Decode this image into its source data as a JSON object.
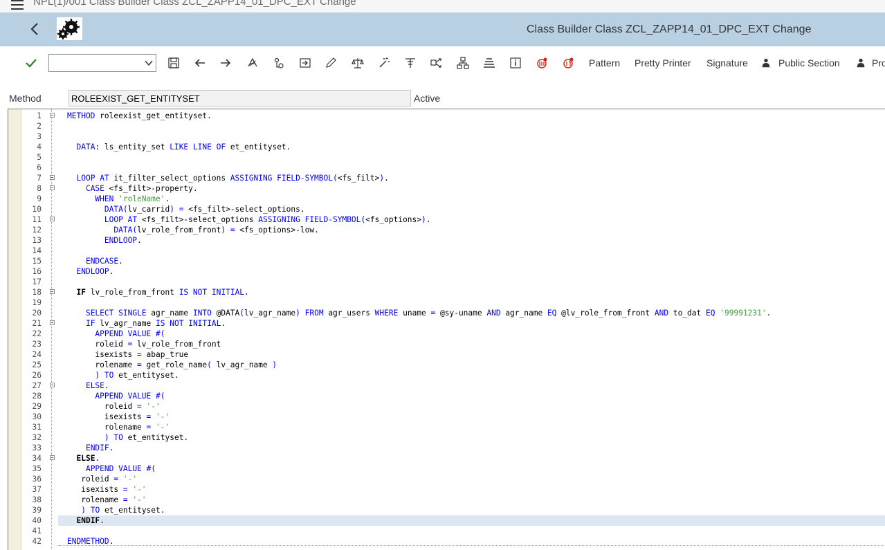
{
  "window": {
    "title": "NPL(1)/001 Class Builder Class ZCL_ZAPP14_01_DPC_EXT Change"
  },
  "shell": {
    "app_title": "Class Builder Class ZCL_ZAPP14_01_DPC_EXT Change"
  },
  "toolbar": {
    "command_value": "",
    "buttons": {
      "pattern": "Pattern",
      "pretty_printer": "Pretty Printer",
      "signature": "Signature",
      "public_section": "Public Section",
      "protected_section": "Pro"
    }
  },
  "method": {
    "label": "Method",
    "name": "ROLEEXIST_GET_ENTITYSET",
    "status": "Active"
  },
  "editor": {
    "highlighted_line": 40,
    "lines": [
      {
        "n": "1",
        "t": "METHOD roleexist_get_entityset."
      },
      {
        "n": "2",
        "t": ""
      },
      {
        "n": "3",
        "t": ""
      },
      {
        "n": "4",
        "t": "  DATA: ls_entity_set LIKE LINE OF et_entityset."
      },
      {
        "n": "5",
        "t": ""
      },
      {
        "n": "6",
        "t": ""
      },
      {
        "n": "7",
        "t": "  LOOP AT it_filter_select_options ASSIGNING FIELD-SYMBOL(<fs_filt>)."
      },
      {
        "n": "8",
        "t": "    CASE <fs_filt>-property."
      },
      {
        "n": "9",
        "t": "      WHEN 'roleName'."
      },
      {
        "n": "10",
        "t": "        DATA(lv_carrid) = <fs_filt>-select_options."
      },
      {
        "n": "11",
        "t": "        LOOP AT <fs_filt>-select_options ASSIGNING FIELD-SYMBOL(<fs_options>)."
      },
      {
        "n": "12",
        "t": "          DATA(lv_role_from_front) = <fs_options>-low."
      },
      {
        "n": "13",
        "t": "        ENDLOOP."
      },
      {
        "n": "14",
        "t": ""
      },
      {
        "n": "15",
        "t": "    ENDCASE."
      },
      {
        "n": "16",
        "t": "  ENDLOOP."
      },
      {
        "n": "17",
        "t": ""
      },
      {
        "n": "18",
        "t": "  IF lv_role_from_front IS NOT INITIAL."
      },
      {
        "n": "19",
        "t": ""
      },
      {
        "n": "20",
        "t": "    SELECT SINGLE agr_name INTO @DATA(lv_agr_name) FROM agr_users WHERE uname = @sy-uname AND agr_name EQ @lv_role_from_front AND to_dat EQ '99991231'."
      },
      {
        "n": "21",
        "t": "    IF lv_agr_name IS NOT INITIAL."
      },
      {
        "n": "22",
        "t": "      APPEND VALUE #("
      },
      {
        "n": "23",
        "t": "      roleid = lv_role_from_front"
      },
      {
        "n": "24",
        "t": "      isexists = abap_true"
      },
      {
        "n": "25",
        "t": "      rolename = get_role_name( lv_agr_name )"
      },
      {
        "n": "26",
        "t": "      ) TO et_entityset."
      },
      {
        "n": "27",
        "t": "    ELSE."
      },
      {
        "n": "28",
        "t": "      APPEND VALUE #("
      },
      {
        "n": "29",
        "t": "        roleid = '-'"
      },
      {
        "n": "30",
        "t": "        isexists = '-'"
      },
      {
        "n": "31",
        "t": "        rolename = '-'"
      },
      {
        "n": "32",
        "t": "        ) TO et_entityset."
      },
      {
        "n": "33",
        "t": "    ENDIF."
      },
      {
        "n": "34",
        "t": "  ELSE."
      },
      {
        "n": "35",
        "t": "    APPEND VALUE #("
      },
      {
        "n": "36",
        "t": "   roleid = '-'"
      },
      {
        "n": "37",
        "t": "   isexists = '-'"
      },
      {
        "n": "38",
        "t": "   rolename = '-'"
      },
      {
        "n": "39",
        "t": "   ) TO et_entityset."
      },
      {
        "n": "40",
        "t": "  ENDIF."
      },
      {
        "n": "41",
        "t": ""
      },
      {
        "n": "42",
        "t": "ENDMETHOD."
      }
    ],
    "fold_lines": [
      1,
      7,
      8,
      11,
      18,
      21,
      27,
      34
    ]
  }
}
